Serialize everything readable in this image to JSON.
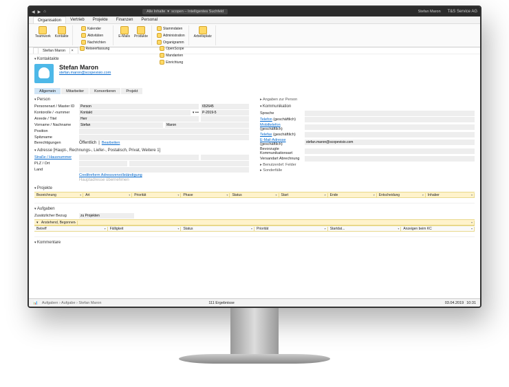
{
  "titlebar": {
    "filter_label": "Alle Inhalte",
    "search_placeholder": "scopen – Intelligentes Suchfeld",
    "user": "Stefan Maron",
    "company": "T&S Service AG"
  },
  "ribbon_tabs": [
    "Organisation",
    "Vertrieb",
    "Projekte",
    "Finanzen",
    "Personal"
  ],
  "ribbon_active": 0,
  "ribbon": {
    "teamwork": "Teamwork",
    "kontakte": "Kontakte",
    "kalender": "Kalender",
    "aktivitaeten": "Aktivitäten",
    "nachrichten": "Nachrichten",
    "reiseerfassung": "Reiseerfassung",
    "emails": "E-Mails",
    "produkte": "Produkte",
    "stammdaten": "Stammdaten",
    "administration": "Administration",
    "organigramm": "Organigramm",
    "openscope": "OpenScope",
    "mandanten": "Mandanten",
    "einrichtung": "Einrichtung",
    "arbeitsplatz": "Arbeitsplatz"
  },
  "doc_tab": "Stefan Maron",
  "sections": {
    "kontaktakte": "Kontaktakte"
  },
  "contact": {
    "name": "Stefan Maron",
    "email": "stefan.maron@scopevisio.com"
  },
  "subtabs": [
    "Allgemein",
    "Mitarbeiter",
    "Konvertieren",
    "Projekt"
  ],
  "subtabs_active": 0,
  "person_section": "Person",
  "fields": {
    "personenart_label": "Personenart / Master ID",
    "personenart_value": "Person",
    "master_id": "652645",
    "kontorolle_label": "Kontorolle / -nummer",
    "kontorolle_value": "Kontakt",
    "kontonummer": "P-2019-5",
    "anrede_label": "Anrede / Titel",
    "anrede_value": "Herr",
    "vorname_label": "Vorname / Nachname",
    "vorname_value": "Stefan",
    "nachname_value": "Maron",
    "position_label": "Position",
    "spitzname_label": "Spitzname",
    "berechtigungen_label": "Berechtigungen",
    "berechtigungen_value": "Öffentlich",
    "bearbeiten": "Bearbeiten"
  },
  "adresse": {
    "header": "Adresse  [Haupt-, Rechnungs-, Liefer-, Postalisch, Privat, Weitere 1]",
    "strasse_label": "Straße / Hausnummer",
    "plz_label": "PLZ / Ort",
    "land_label": "Land",
    "crediform": "Creditreform Adressvervollständigung",
    "hauptadresse": "Hauptadresse übernehmen"
  },
  "angaben": {
    "header": "Angaben zur Person",
    "kommunikation": "Kommunikation",
    "sprache_label": "Sprache",
    "telefon_label": "Telefon",
    "geschaeftlich": "(geschäftlich)",
    "mobil_label": "Mobiltelefon",
    "telefax_label": "Telefax",
    "email_label": "E-Mail-Adresse",
    "email_value": "stefan.maron@scopevisio.com",
    "bevorzugte_label": "Bevorzugte Kommunikationsart",
    "versandart_label": "Versandart Abrechnung",
    "benutzerdef": "Benutzerdef. Felder",
    "sonderfaelle": "Sonderfälle"
  },
  "projekte": {
    "header": "Projekte",
    "cols": [
      "Bezeichnung",
      "Art",
      "Priorität",
      "Phase",
      "Status",
      "Start",
      "Ende",
      "Entscheidung",
      "Inhaber"
    ]
  },
  "aufgaben": {
    "header": "Aufgaben",
    "bezug_label": "Zusätzlicher Bezug",
    "bezug_value": "zu Projekten",
    "filter": "Anstehend, Begonnen",
    "cols": [
      "Betreff",
      "Fälligkeit",
      "Status",
      "Priorität",
      "Startdat...",
      "Anzeigen beim KC"
    ]
  },
  "kommentare": "Kommentare",
  "statusbar": {
    "crumb1": "Aufgaben",
    "crumb2": "Aufgabe",
    "crumb3": "Stefan Maron",
    "results": "111 Ergebnisse",
    "date": "03.04.2019",
    "time": "10:31"
  }
}
